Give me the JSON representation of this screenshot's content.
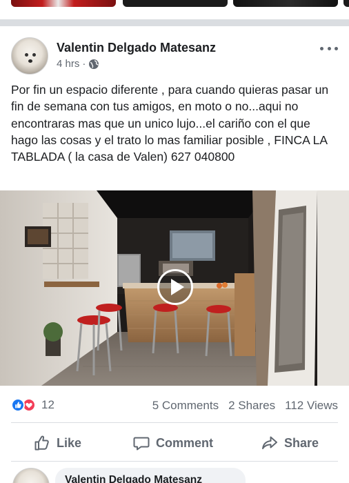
{
  "post": {
    "author": "Valentin Delgado Matesanz",
    "time": "4 hrs",
    "separator": "·",
    "text": "Por fin un espacio diferente , para cuando quieras pasar un fin de semana con tus amigos, en moto o no...aqui no encontraras mas que un unico lujo...el cariño con el que hago las cosas y el trato lo mas familiar posible , FINCA LA TABLADA ( la casa de Valen) 627 040800"
  },
  "stats": {
    "reaction_count": "12",
    "comments": "5 Comments",
    "shares": "2 Shares",
    "views": "112 Views"
  },
  "actions": {
    "like": "Like",
    "comment": "Comment",
    "share": "Share"
  },
  "comment_preview": {
    "author": "Valentin Delgado Matesanz"
  },
  "icons": {
    "privacy": "globe-icon",
    "options": "more-horizontal-icon",
    "reactions": [
      "like-reaction-icon",
      "love-reaction-icon"
    ],
    "play": "play-icon"
  },
  "colors": {
    "brand_blue": "#1877f2",
    "love_red": "#f33e58",
    "secondary_text": "#606770",
    "divider": "#dadde1"
  }
}
